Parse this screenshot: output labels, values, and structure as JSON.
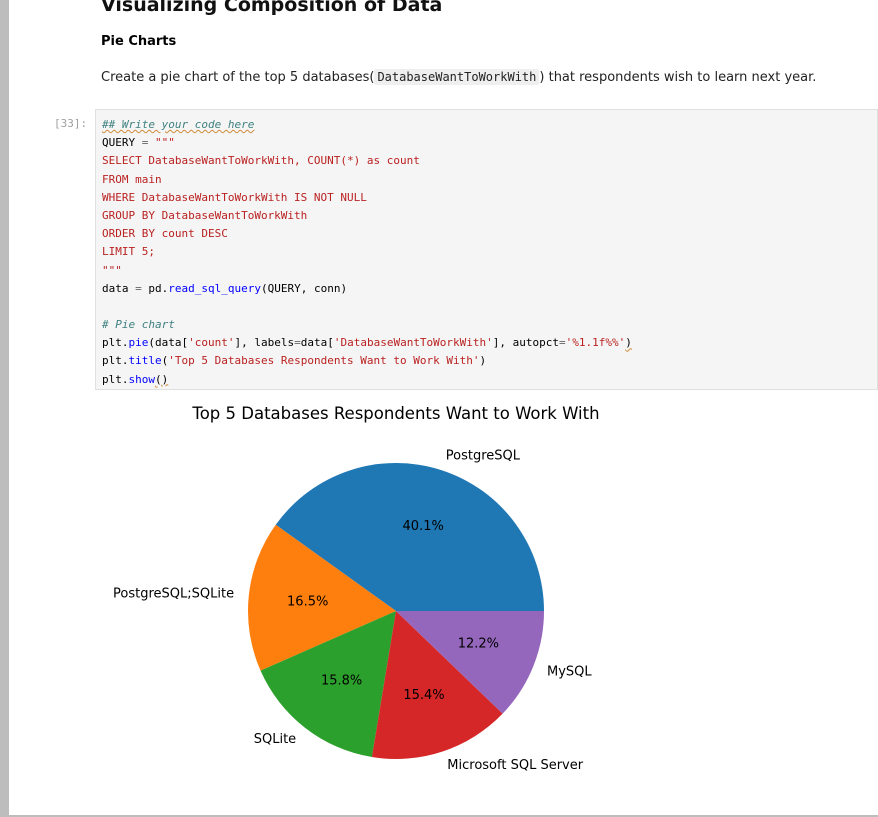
{
  "notebook": {
    "heading": "Visualizing Composition of Data",
    "subheading": "Pie Charts",
    "instruction_before": "Create a pie chart of the top 5 databases(",
    "instruction_code": "DatabaseWantToWorkWith",
    "instruction_after": ") that respondents wish to learn next year.",
    "cell_prompt": "[33]:",
    "code": {
      "l1": "## Write your code here",
      "l2a": "QUERY",
      "l2b": " = ",
      "l2c": "\"\"\"",
      "l3": "SELECT DatabaseWantToWorkWith, COUNT(*) as count",
      "l4": "FROM main",
      "l5": "WHERE DatabaseWantToWorkWith IS NOT NULL",
      "l6": "GROUP BY DatabaseWantToWorkWith",
      "l7": "ORDER BY count DESC",
      "l8": "LIMIT 5;",
      "l9": "\"\"\"",
      "l10a": "data",
      "l10b": " = ",
      "l10c": "pd.",
      "l10d": "read_sql_query",
      "l10e": "(QUERY, conn)",
      "l12": "# Pie chart",
      "l13a": "plt.",
      "l13b": "pie",
      "l13c": "(data[",
      "l13d": "'count'",
      "l13e": "], labels",
      "l13f": "=",
      "l13g": "data[",
      "l13h": "'DatabaseWantToWorkWith'",
      "l13i": "], autopct",
      "l13j": "=",
      "l13k": "'%1.1f%%'",
      "l13l": ")",
      "l14a": "plt.",
      "l14b": "title",
      "l14c": "(",
      "l14d": "'Top 5 Databases Respondents Want to Work With'",
      "l14e": ")",
      "l15a": "plt.",
      "l15b": "show",
      "l15c": "()"
    }
  },
  "chart_data": {
    "type": "pie",
    "title": "Top 5 Databases Respondents Want to Work With",
    "start_angle_deg": 0,
    "direction": "counterclockwise",
    "slices": [
      {
        "label": "PostgreSQL",
        "value": 40.1,
        "pct_label": "40.1%",
        "color": "#1f77b4"
      },
      {
        "label": "PostgreSQL;SQLite",
        "value": 16.5,
        "pct_label": "16.5%",
        "color": "#ff7f0e"
      },
      {
        "label": "SQLite",
        "value": 15.8,
        "pct_label": "15.8%",
        "color": "#2ca02c"
      },
      {
        "label": "Microsoft SQL Server",
        "value": 15.4,
        "pct_label": "15.4%",
        "color": "#d62728"
      },
      {
        "label": "MySQL",
        "value": 12.2,
        "pct_label": "12.2%",
        "color": "#9467bd"
      }
    ]
  }
}
